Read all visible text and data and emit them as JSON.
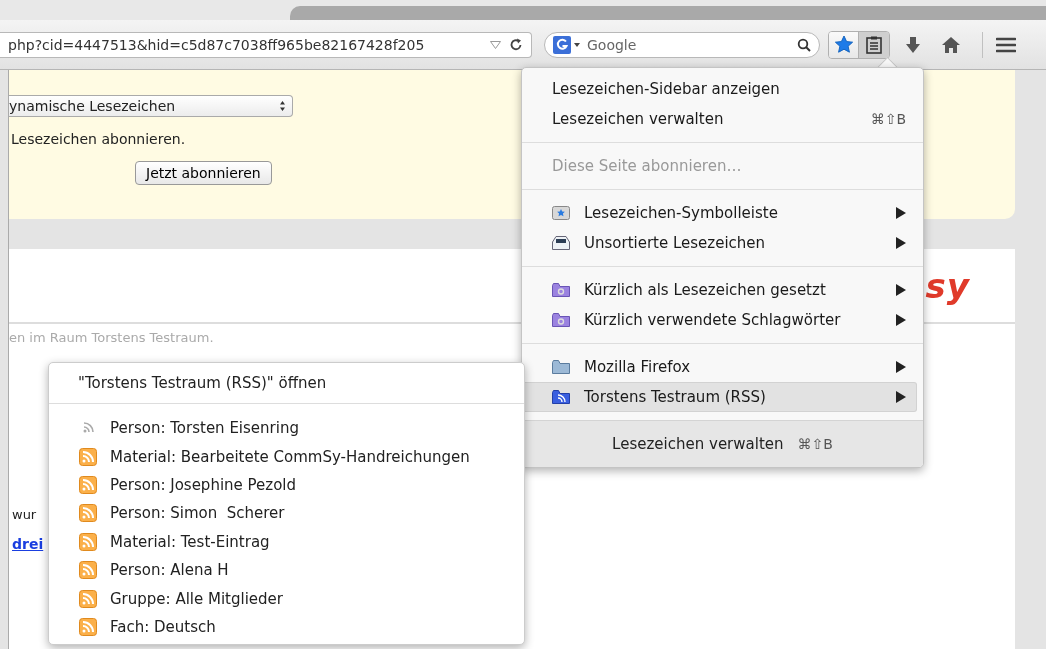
{
  "toolbar": {
    "url": "php?cid=4447513&hid=c5d87c7038ff965be82167428f205",
    "search": {
      "placeholder": "Google"
    },
    "bookmark_star_on": true,
    "bookmarks_menu_open": true
  },
  "page": {
    "select_value": "ynamische Lesezeichen",
    "subscribe_text": "Lesezeichen abonnieren.",
    "subscribe_button": "Jetzt abonnieren",
    "room_text": "en im Raum Torstens Testraum.",
    "logo_text": "sy",
    "body_text": "wur",
    "link_text": "drei"
  },
  "bookmarks_menu": {
    "items": [
      {
        "kind": "action",
        "label": "Lesezeichen-Sidebar anzeigen",
        "disabled": false
      },
      {
        "kind": "action",
        "label": "Lesezeichen verwalten",
        "shortcut": "⌘⇧B",
        "disabled": false
      },
      {
        "kind": "separator"
      },
      {
        "kind": "action",
        "label": "Diese Seite abonnieren…",
        "disabled": true
      },
      {
        "kind": "separator"
      },
      {
        "kind": "toolbar",
        "label": "Lesezeichen-Symbolleiste",
        "selected": false
      },
      {
        "kind": "unsorted",
        "label": "Unsortierte Lesezeichen",
        "selected": false
      },
      {
        "kind": "separator"
      },
      {
        "kind": "smart",
        "label": "Kürzlich als Lesezeichen gesetzt",
        "selected": false
      },
      {
        "kind": "smart",
        "label": "Kürzlich verwendete Schlagwörter",
        "selected": false
      },
      {
        "kind": "separator"
      },
      {
        "kind": "folder",
        "label": "Mozilla Firefox",
        "selected": false
      },
      {
        "kind": "feed",
        "label": "Torstens Testraum (RSS)",
        "selected": true
      }
    ],
    "footer": {
      "label": "Lesezeichen verwalten",
      "shortcut": "⌘⇧B"
    }
  },
  "submenu": {
    "open_label": "\"Torstens Testraum (RSS)\" öffnen",
    "items": [
      {
        "kind": "plain",
        "label": "Person: Torsten Eisenring"
      },
      {
        "kind": "feed",
        "label": "Material: Bearbeitete CommSy-Handreichungen"
      },
      {
        "kind": "feed",
        "label": "Person: Josephine Pezold"
      },
      {
        "kind": "feed",
        "label": "Person: Simon  Scherer"
      },
      {
        "kind": "feed",
        "label": "Material: Test-Eintrag"
      },
      {
        "kind": "feed",
        "label": "Person: Alena H"
      },
      {
        "kind": "feed",
        "label": "Gruppe: Alle Mitglieder"
      },
      {
        "kind": "feed",
        "label": "Fach: Deutsch"
      }
    ]
  }
}
